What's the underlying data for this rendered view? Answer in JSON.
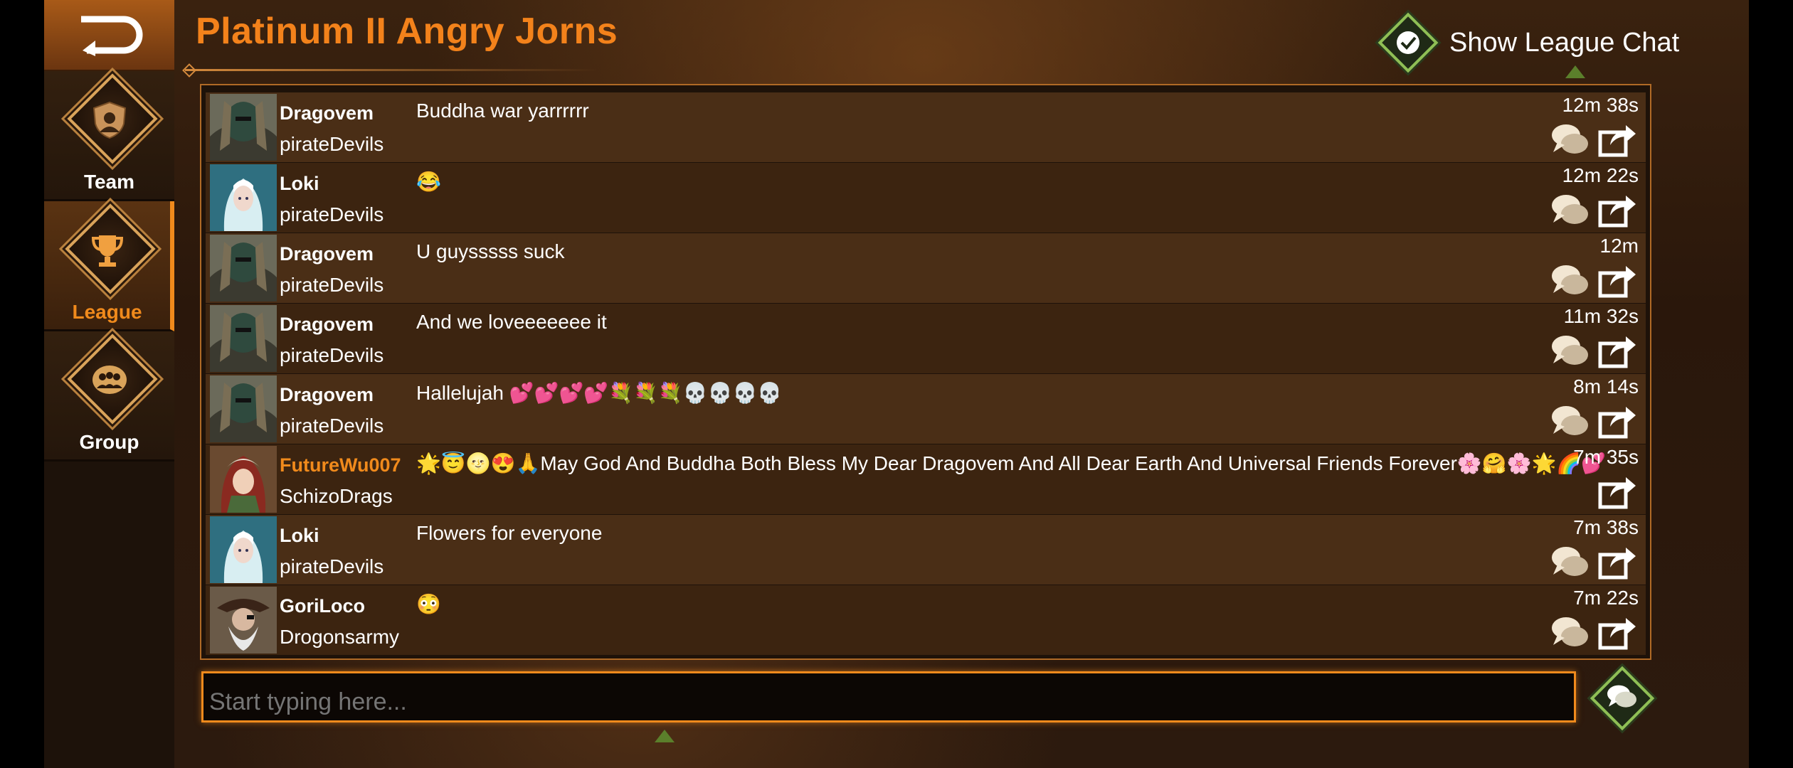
{
  "header": {
    "title": "Platinum II Angry Jorns",
    "show_chat_label": "Show League Chat",
    "show_chat_checked": true
  },
  "sidebar": {
    "items": [
      {
        "label": "Team",
        "icon": "team-shield-icon",
        "active": false
      },
      {
        "label": "League",
        "icon": "trophy-icon",
        "active": true
      },
      {
        "label": "Group",
        "icon": "group-people-icon",
        "active": false
      }
    ]
  },
  "messages": [
    {
      "name": "Dragovem",
      "group": "pirateDevils",
      "text": "Buddha war yarrrrrr",
      "time": "12m 38s",
      "avatar": "masked-figure",
      "name_color": "#ffffff",
      "reply": true
    },
    {
      "name": "Loki",
      "group": "pirateDevils",
      "text": "😂",
      "time": "12m 22s",
      "avatar": "ice-maiden",
      "name_color": "#ffffff",
      "reply": true
    },
    {
      "name": "Dragovem",
      "group": "pirateDevils",
      "text": "U guysssss suck",
      "time": "12m",
      "avatar": "masked-figure",
      "name_color": "#ffffff",
      "reply": true
    },
    {
      "name": "Dragovem",
      "group": "pirateDevils",
      "text": "And we loveeeeeee it",
      "time": "11m 32s",
      "avatar": "masked-figure",
      "name_color": "#ffffff",
      "reply": true
    },
    {
      "name": "Dragovem",
      "group": "pirateDevils",
      "text": "Hallelujah 💕💕💕💕💐💐💐💀💀💀💀",
      "time": "8m 14s",
      "avatar": "masked-figure",
      "name_color": "#ffffff",
      "reply": true
    },
    {
      "name": "FutureWu007",
      "group": "SchizoDrags",
      "text": "🌟😇🌝😍🙏May God And Buddha Both Bless My Dear Dragovem And All Dear Earth And Universal Friends Forever🌸🤗🌸🌟🌈💕",
      "time": "7m 35s",
      "avatar": "hooded-archer",
      "name_color": "#f08a1c",
      "reply": false
    },
    {
      "name": "Loki",
      "group": "pirateDevils",
      "text": "Flowers for everyone",
      "time": "7m 38s",
      "avatar": "ice-maiden",
      "name_color": "#ffffff",
      "reply": true
    },
    {
      "name": "GoriLoco",
      "group": "Drogonsarmy",
      "text": "😳",
      "time": "7m 22s",
      "avatar": "old-pirate",
      "name_color": "#ffffff",
      "reply": true
    }
  ],
  "input": {
    "placeholder": "Start typing here..."
  },
  "colors": {
    "accent": "#f08a1c",
    "title": "#f3821b",
    "confirm_green": "#8fbf55"
  }
}
